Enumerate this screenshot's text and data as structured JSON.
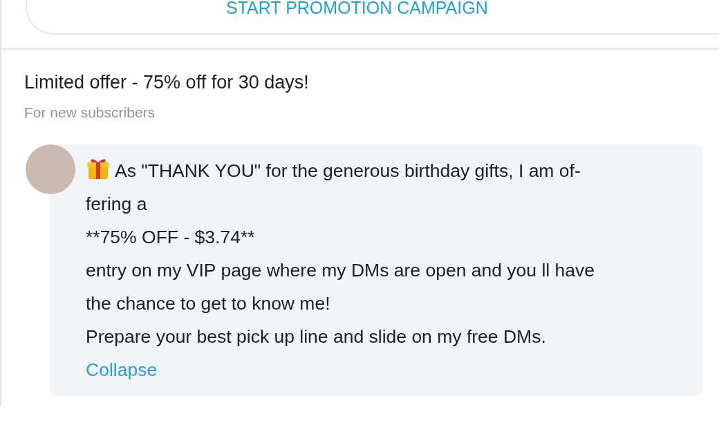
{
  "promo_button": {
    "label": "START PROMOTION CAMPAIGN"
  },
  "offer": {
    "title": "Limited offer - 75% off for 30 days!",
    "subtitle": "For new subscribers"
  },
  "message": {
    "lines": [
      "As \"THANK YOU\" for the generous birthday gifts, I am of-",
      "fering a",
      "**75% OFF - $3.74**",
      "entry on my VIP page where my DMs are open and you ll have",
      "the chance to get to know me!",
      "Prepare your best pick up line and slide on my free DMs."
    ],
    "collapse_link": "Collapse"
  }
}
